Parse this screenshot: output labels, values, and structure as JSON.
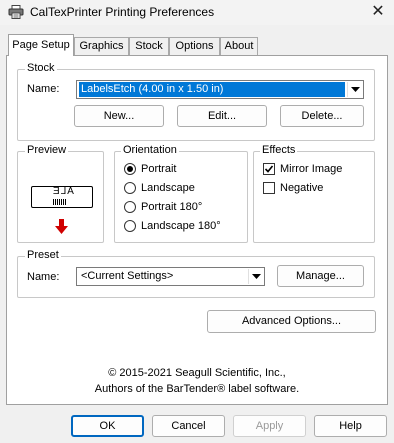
{
  "window": {
    "title": "CalTexPrinter Printing Preferences",
    "close_glyph": "✕"
  },
  "tabs": [
    {
      "label": "Page Setup",
      "active": true
    },
    {
      "label": "Graphics"
    },
    {
      "label": "Stock"
    },
    {
      "label": "Options"
    },
    {
      "label": "About"
    }
  ],
  "stock": {
    "group_title": "Stock",
    "name_label": "Name:",
    "name_value": "LabelsEtch (4.00 in x 1.50 in)",
    "new_button": "New...",
    "edit_button": "Edit...",
    "delete_button": "Delete..."
  },
  "preview": {
    "group_title": "Preview",
    "label_text": "ALE",
    "arrow_color": "#d00000"
  },
  "orientation": {
    "group_title": "Orientation",
    "options": [
      {
        "label": "Portrait",
        "selected": true
      },
      {
        "label": "Landscape",
        "selected": false
      },
      {
        "label": "Portrait 180°",
        "selected": false
      },
      {
        "label": "Landscape 180°",
        "selected": false
      }
    ]
  },
  "effects": {
    "group_title": "Effects",
    "options": [
      {
        "label": "Mirror Image",
        "checked": true
      },
      {
        "label": "Negative",
        "checked": false
      }
    ]
  },
  "preset": {
    "group_title": "Preset",
    "name_label": "Name:",
    "name_value": "<Current Settings>",
    "manage_button": "Manage..."
  },
  "advanced_button": "Advanced Options...",
  "footer": {
    "copyright": "© 2015-2021 Seagull Scientific, Inc.,",
    "authors": "Authors of the BarTender® label software."
  },
  "buttons": {
    "ok": "OK",
    "cancel": "Cancel",
    "apply": "Apply",
    "help": "Help"
  }
}
